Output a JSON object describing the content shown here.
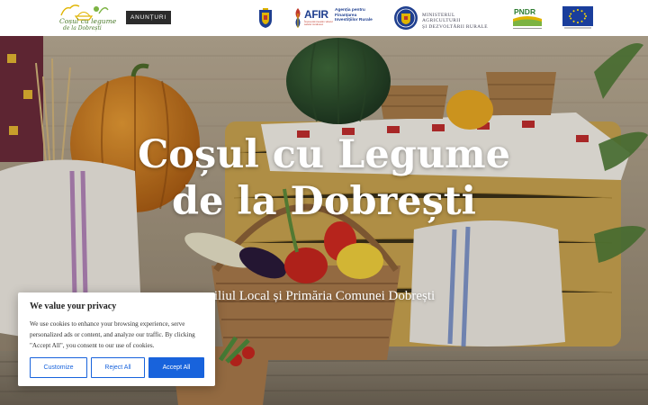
{
  "header": {
    "logo": {
      "line1": "Coșul cu legume",
      "line2": "de la Dobrești"
    },
    "announcements_label": "ANUNȚURI",
    "partners": {
      "afir": {
        "title": "AFIR",
        "subtitle": "Agenția pentru Finanțarea Investițiilor Rurale",
        "tagline": "Împreună investim viitorul satului românesc"
      },
      "madr": {
        "line1": "MINISTERUL AGRICULTURII",
        "line2": "ȘI DEZVOLTĂRII RURALE"
      },
      "pndr": {
        "label": "PNDR"
      }
    }
  },
  "hero": {
    "title_line1": "Coșul cu Legume",
    "title_line2": "de la Dobrești",
    "subtitle": "siliul Local și Primăria Comunei Dobrești"
  },
  "cookie_banner": {
    "title": "We value your privacy",
    "text": "We use cookies to enhance your browsing experience, serve personalized ads or content, and analyze our traffic. By clicking \"Accept All\", you consent to our use of cookies.",
    "customize_label": "Customize",
    "reject_label": "Reject All",
    "accept_label": "Accept All"
  },
  "colors": {
    "accent": "#1863dc",
    "header_button": "#2b2b2b",
    "afir_blue": "#1f3f8f",
    "pndr_green": "#2e7d32",
    "eu_blue": "#1a3e9c"
  }
}
